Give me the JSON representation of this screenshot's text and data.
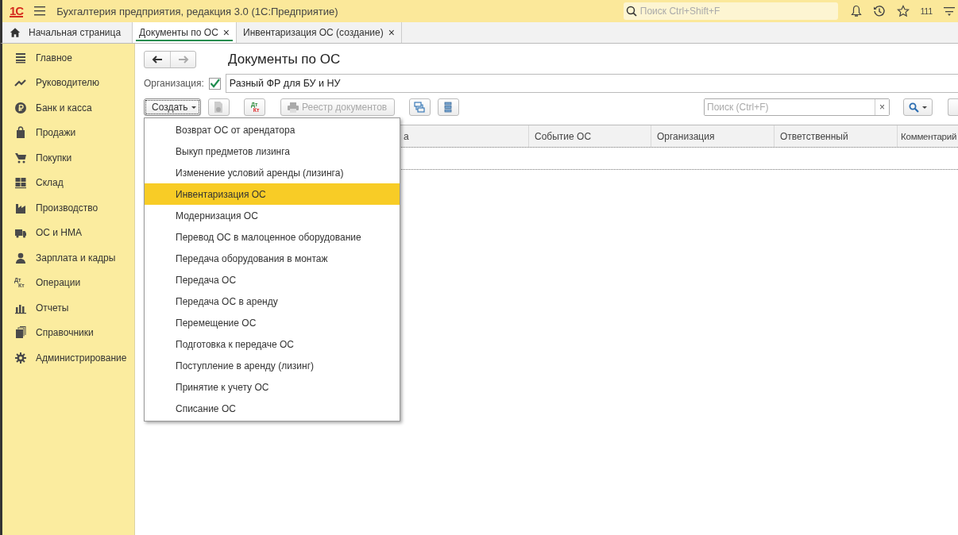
{
  "topbar": {
    "logo": "1С",
    "title": "Бухгалтерия предприятия, редакция 3.0  (1С:Предприятие)",
    "search": {
      "placeholder": "Поиск Ctrl+Shift+F"
    },
    "count": "111"
  },
  "tabs": [
    {
      "label": "Начальная страница",
      "kind": "home",
      "selected": false
    },
    {
      "label": "Документы по ОС",
      "kind": "doc",
      "selected": true,
      "close": "×"
    },
    {
      "label": "Инвентаризация ОС (создание)",
      "kind": "doc",
      "selected": false,
      "close": "×"
    }
  ],
  "sidebar": {
    "items": [
      {
        "label": "Главное"
      },
      {
        "label": "Руководителю"
      },
      {
        "label": "Банк и касса"
      },
      {
        "label": "Продажи"
      },
      {
        "label": "Покупки"
      },
      {
        "label": "Склад"
      },
      {
        "label": "Производство"
      },
      {
        "label": "ОС и НМА"
      },
      {
        "label": "Зарплата и кадры"
      },
      {
        "label": "Операции",
        "icon_text": [
          "Дт",
          "Кт"
        ]
      },
      {
        "label": "Отчеты"
      },
      {
        "label": "Справочники"
      },
      {
        "label": "Администрирование"
      }
    ]
  },
  "form": {
    "title": "Документы по ОС",
    "organization": {
      "label": "Организация:",
      "checked": true,
      "value": "Разный ФР для БУ и НУ"
    },
    "toolbar": {
      "create": "Создать",
      "dtkt": [
        "Дт",
        "Кт"
      ],
      "registry": "Реестр документов",
      "search": {
        "placeholder": "Поиск (Ctrl+F)",
        "clear": "×"
      }
    },
    "table": {
      "columns": [
        {
          "label": "а"
        },
        {
          "label": "Событие ОС"
        },
        {
          "label": "Организация"
        },
        {
          "label": "Ответственный"
        },
        {
          "label": "Комментарий"
        }
      ]
    },
    "create_menu": [
      {
        "label": "Возврат ОС от арендатора",
        "selected": false
      },
      {
        "label": "Выкуп предметов лизинга",
        "selected": false
      },
      {
        "label": "Изменение условий аренды (лизинга)",
        "selected": false
      },
      {
        "label": "Инвентаризация ОС",
        "selected": true
      },
      {
        "label": "Модернизация ОС",
        "selected": false
      },
      {
        "label": "Перевод ОС в малоценное оборудование",
        "selected": false
      },
      {
        "label": "Передача оборудования в монтаж",
        "selected": false
      },
      {
        "label": "Передача ОС",
        "selected": false
      },
      {
        "label": "Передача ОС в аренду",
        "selected": false
      },
      {
        "label": "Перемещение ОС",
        "selected": false
      },
      {
        "label": "Подготовка к передаче ОС",
        "selected": false
      },
      {
        "label": "Поступление в аренду (лизинг)",
        "selected": false
      },
      {
        "label": "Принятие к учету ОС",
        "selected": false
      },
      {
        "label": "Списание ОС",
        "selected": false
      }
    ]
  }
}
